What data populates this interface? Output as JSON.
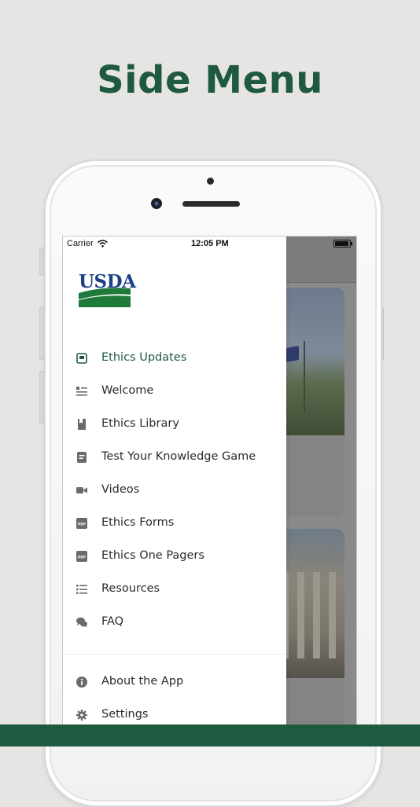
{
  "headline": "Side Menu",
  "status_bar": {
    "carrier": "Carrier",
    "time": "12:05 PM"
  },
  "logo": {
    "text": "USDA",
    "brand_blue": "#1b3f88",
    "brand_green": "#1e7a3a"
  },
  "colors": {
    "accent": "#1f5a40",
    "background": "#e6e5e4"
  },
  "menu": {
    "items": [
      {
        "label": "Ethics Updates",
        "icon": "news-icon",
        "active": true
      },
      {
        "label": "Welcome",
        "icon": "list-lines-icon",
        "active": false
      },
      {
        "label": "Ethics Library",
        "icon": "bookmark-book-icon",
        "active": false
      },
      {
        "label": "Test Your Knowledge Game",
        "icon": "quiz-card-icon",
        "active": false
      },
      {
        "label": "Videos",
        "icon": "video-camera-icon",
        "active": false
      },
      {
        "label": "Ethics Forms",
        "icon": "pdf-icon",
        "active": false
      },
      {
        "label": "Ethics One Pagers",
        "icon": "pdf-icon",
        "active": false
      },
      {
        "label": "Resources",
        "icon": "bullet-list-icon",
        "active": false
      },
      {
        "label": "FAQ",
        "icon": "chat-bubbles-icon",
        "active": false
      }
    ],
    "footer_items": [
      {
        "label": "About the App",
        "icon": "info-icon"
      },
      {
        "label": "Settings",
        "icon": "gear-icon"
      }
    ]
  }
}
